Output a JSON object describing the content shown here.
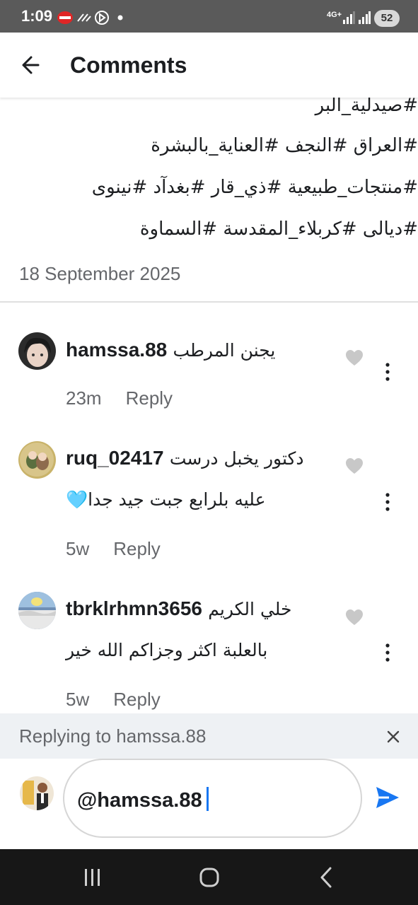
{
  "status_bar": {
    "time": "1:09",
    "network": "4G+",
    "battery": "52"
  },
  "header": {
    "title": "Comments"
  },
  "caption": {
    "lines": [
      "#صيدلية_البر",
      "#العراق #النجف #العناية_بالبشرة",
      "#منتجات_طبيعية #ذي_قار #بغدآد #نينوى",
      "#ديالى #كربلاء_المقدسة #السماوة"
    ],
    "date": "18 September 2025"
  },
  "comments": [
    {
      "username": "hamssa.88",
      "text_line1": "يجنن المرطب",
      "text_line2": "",
      "time": "23m",
      "reply_label": "Reply"
    },
    {
      "username": "ruq_02417",
      "text_line1": "دكتور يخبل درست",
      "text_line2": "عليه بلرابع جبت جيد جدا🩵",
      "time": "5w",
      "reply_label": "Reply"
    },
    {
      "username": "tbrklrhmn3656",
      "text_line1": "خلي  الكريم",
      "text_line2": "بالعلبة اكثر  وجزاكم الله خير",
      "time": "5w",
      "reply_label": "Reply"
    }
  ],
  "replying": {
    "text": "Replying to hamssa.88"
  },
  "composer": {
    "value": "@hamssa.88"
  },
  "colors": {
    "accent": "#1877f2",
    "muted": "#65676b",
    "heart": "#c8c8c8"
  },
  "icons": [
    "back-arrow-icon",
    "heart-icon",
    "more-vertical-icon",
    "close-icon",
    "send-icon",
    "recents-icon",
    "home-icon",
    "back-icon"
  ]
}
